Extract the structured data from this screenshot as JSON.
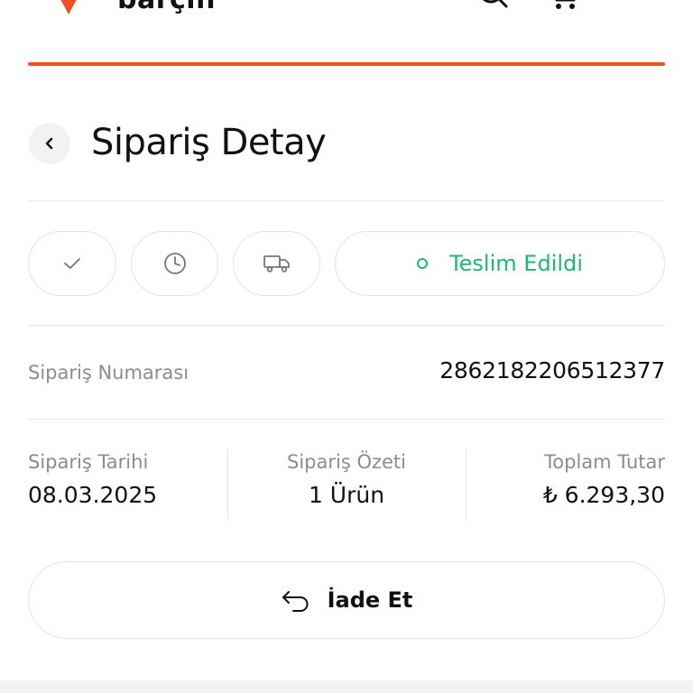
{
  "header": {
    "brand": "barçın",
    "accent_color": "#f04e23",
    "icons": [
      "logo-mark",
      "search-icon",
      "cart-icon",
      "menu-icon"
    ]
  },
  "title": {
    "text": "Sipariş Detay",
    "back_icon": "chevron-left-icon"
  },
  "status": {
    "steps": [
      {
        "icon": "check-icon"
      },
      {
        "icon": "clock-icon"
      },
      {
        "icon": "truck-icon"
      }
    ],
    "current": "Teslim Edildi",
    "current_color": "#22b573"
  },
  "order": {
    "number_label": "Sipariş Numarası",
    "number_value": "2862182206512377"
  },
  "summary": {
    "date_label": "Sipariş Tarihi",
    "date_value": "08.03.2025",
    "items_label": "Sipariş Özeti",
    "items_value": "1 Ürün",
    "total_label": "Toplam Tutar",
    "total_value": "₺ 6.293,30"
  },
  "actions": {
    "return_label": "İade Et",
    "return_icon": "return-arrow-icon"
  }
}
